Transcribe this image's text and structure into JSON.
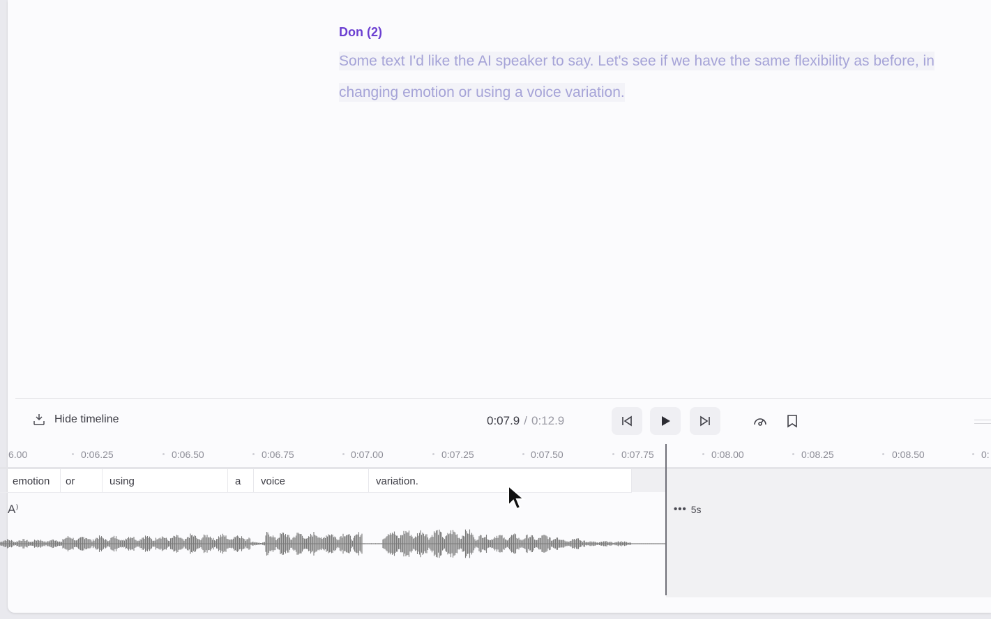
{
  "script": {
    "speaker": "Don (2)",
    "text": "Some text I'd like the AI speaker to say. Let's see if we have the same flexibility as before, in changing emotion or using a voice variation."
  },
  "transport": {
    "hide_timeline_label": "Hide timeline",
    "current_time": "0:07.9",
    "separator": "/",
    "total_time": "0:12.9",
    "icons": [
      "hide-timeline-icon",
      "skip-back-icon",
      "play-icon",
      "skip-forward-icon",
      "speed-gauge-icon",
      "bookmark-icon"
    ]
  },
  "ruler": {
    "ticks": [
      "6.00",
      "0:06.25",
      "0:06.50",
      "0:06.75",
      "0:07.00",
      "0:07.25",
      "0:07.50",
      "0:07.75",
      "0:08.00",
      "0:08.25",
      "0:08.50",
      "0:"
    ]
  },
  "words": [
    "emotion",
    "or",
    "using",
    "a",
    "voice",
    "variation."
  ],
  "track": {
    "voice_icon": "A⁾",
    "pause_dots": "•••",
    "pause_duration": "5s"
  },
  "colors": {
    "speaker": "#6b3fd1",
    "script_text": "#a5a3d7",
    "waveform": "#7a7a7a",
    "future_region": "#f1f1f3"
  }
}
